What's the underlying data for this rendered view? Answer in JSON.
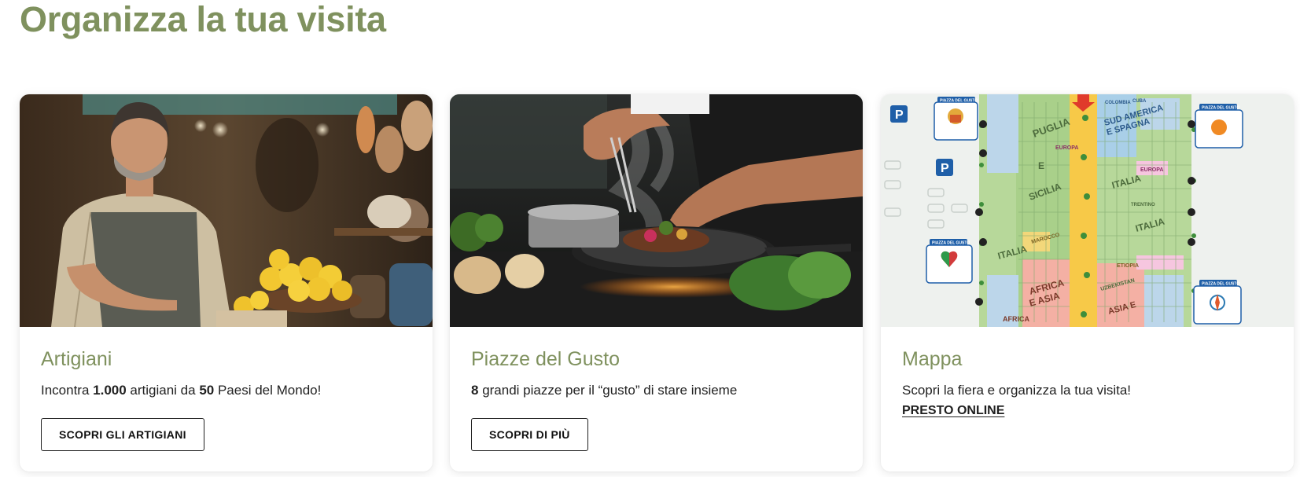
{
  "page": {
    "title": "Organizza la tua visita"
  },
  "cards": [
    {
      "title": "Artigiani",
      "text_parts": [
        "Incontra ",
        "1.000",
        " artigiani da ",
        "50",
        " Paesi del Mondo!"
      ],
      "button_label": "SCOPRI GLI ARTIGIANI",
      "image": "artisan-with-lemons-photo"
    },
    {
      "title": "Piazze del Gusto",
      "text_parts": [
        "8",
        " grandi piazze per il “gusto” di stare insieme"
      ],
      "button_label": "SCOPRI DI PIÙ",
      "image": "chef-cooking-pan-photo"
    },
    {
      "title": "Mappa",
      "text": "Scopri la fiera e organizza la tua visita!",
      "link_label": "PRESTO ONLINE",
      "image": "fair-map-illustration",
      "map_labels": {
        "regions": [
          "PUGLIA",
          "E",
          "SICILIA",
          "ITALIA",
          "MAROCCO",
          "AFRICA",
          "E ASIA",
          "EUROPA",
          "SUD AMERICA",
          "E SPAGNA",
          "ITALIA",
          "TRENTINO",
          "ITALIA",
          "EUROPA",
          "ETIOPIA",
          "UZBEKISTAN",
          "ASIA E",
          "COLOMBIA",
          "CUBA",
          "AFRICA"
        ],
        "badges": [
          "PIAZZA DEL GUSTO",
          "PIAZZA DEL GUSTO",
          "PIAZZA DEL GUSTO",
          "PIAZZA DEL GUSTO"
        ],
        "parking": [
          "P",
          "P"
        ]
      }
    }
  ],
  "colors": {
    "accent": "#7f915e",
    "text": "#222222",
    "button_border": "#1f1f1f",
    "map_green": "#a8d08d",
    "map_yellow": "#f7c948",
    "map_pink": "#f4a9a0",
    "map_blue": "#9cc7e4"
  }
}
